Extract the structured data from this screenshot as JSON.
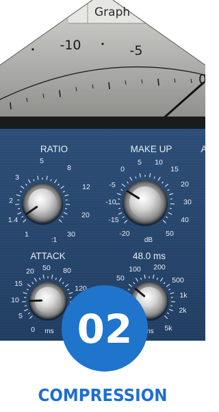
{
  "tab": {
    "label": "Graph"
  },
  "meter": {
    "scale_labels": [
      "-10",
      "-5",
      "0"
    ]
  },
  "ratio": {
    "title": "RATIO",
    "unit": ":1",
    "scale": [
      "1",
      "1.4",
      "2",
      "3",
      "5",
      "8",
      "12",
      "20",
      "30"
    ]
  },
  "makeup": {
    "title": "MAKE UP",
    "unit": "dB",
    "scale": [
      "-20",
      "-15",
      "-10",
      "-5",
      "0",
      "5",
      "10",
      "15",
      "20",
      "30",
      "40",
      "50"
    ]
  },
  "right_edge_title": "A",
  "attack": {
    "title": "ATTACK",
    "unit": "ms",
    "scale": [
      "0",
      "5",
      "10",
      "15",
      "20",
      "50",
      "80",
      "120"
    ]
  },
  "release": {
    "value": "48.0 ms",
    "unit": "ms",
    "scale": [
      "50",
      "100",
      "200",
      "500",
      "1k",
      "2k",
      "5k"
    ]
  },
  "badge": {
    "number": "02"
  },
  "caption": {
    "text": "COMPRESSION"
  },
  "colors": {
    "panel": "#26456b",
    "badge": "#1f74cc",
    "caption": "#1e6fd0",
    "meter_face": "#b3b3b0",
    "knob_tick": "#d8dfe8"
  }
}
